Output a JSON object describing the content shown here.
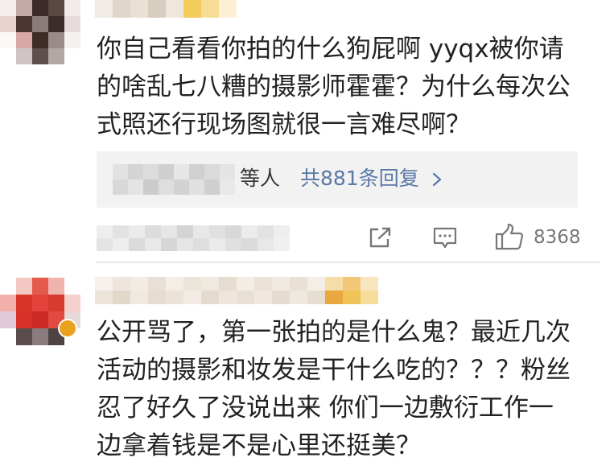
{
  "colors": {
    "text": "#222222",
    "link": "#5a78a8",
    "meta": "#777777",
    "reply_bg": "#f2f2f2",
    "divider": "#e6e6e6"
  },
  "icons": {
    "share": "share-icon",
    "comment": "comment-icon",
    "like": "thumbs-up-icon",
    "more_replies": "chevron-right-icon"
  },
  "comments": [
    {
      "text_lines": [
        "你自己看看你拍的什么狗屁啊 yyqx被你请",
        "的啥乱七八糟的摄影师霍霍？为什么每次公",
        "式照还行现场图就很一言难尽啊？"
      ],
      "replies": {
        "names_suffix": "等人",
        "count_label": "共881条回复"
      },
      "actions": {
        "like_count": "8368"
      }
    },
    {
      "text_lines": [
        "公开骂了，第一张拍的是什么鬼？最近几次",
        "活动的摄影和妆发是干什么吃的？？？粉丝",
        "忍了好久了没说出来 你们一边敷衍工作一",
        "边拿着钱是不是心里还挺美？"
      ]
    }
  ]
}
